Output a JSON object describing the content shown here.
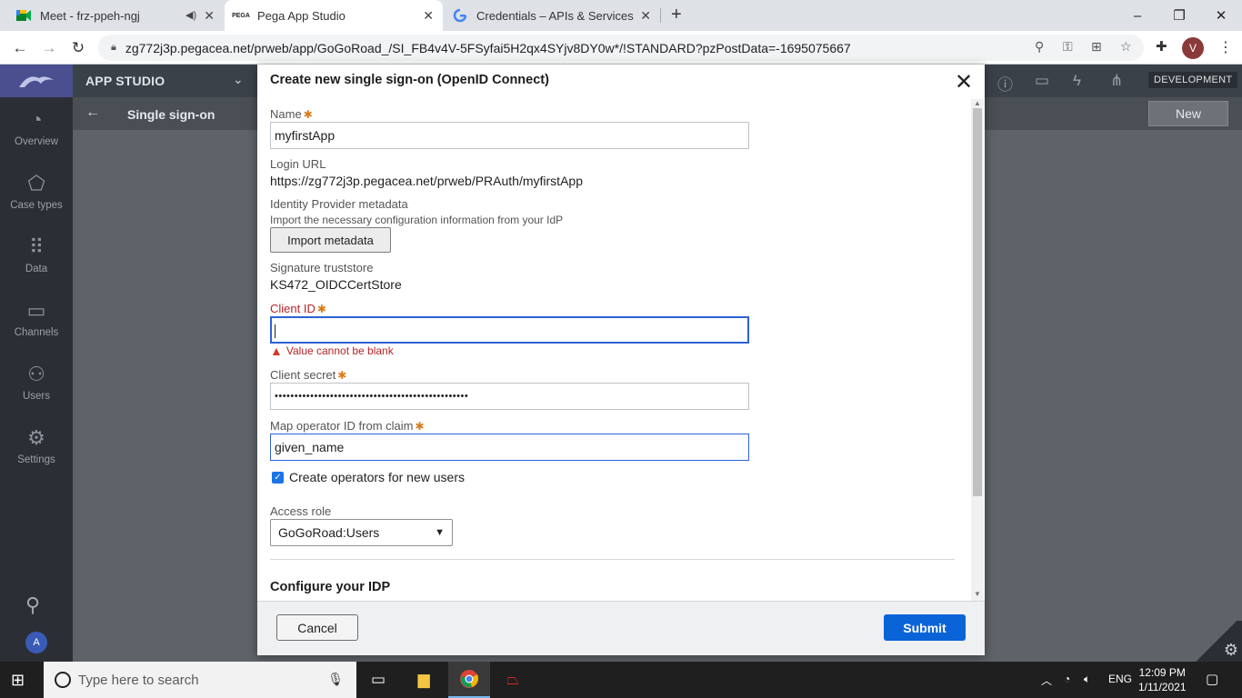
{
  "browser": {
    "tabs": [
      {
        "title": "Meet - frz-ppeh-ngj",
        "favicon": "google-meet-icon",
        "audio_icon": "speaker-icon"
      },
      {
        "title": "Pega App Studio",
        "favicon_text": "PEGA",
        "active": true
      },
      {
        "title": "Credentials – APIs & Services – M",
        "favicon": "google-g-icon"
      }
    ],
    "new_tab": "+",
    "url": "zg772j3p.pegacea.net/prweb/app/GoGoRoad_/SI_FB4v4V-5FSyfai5H2qx4SYjv8DY0w*/!STANDARD?pzPostData=-1695075667",
    "profile_initial": "V"
  },
  "app": {
    "title": "APP STUDIO",
    "environment": "DEVELOPMENT",
    "page_title": "Single sign-on",
    "new_button": "New",
    "nav": [
      {
        "label": "Overview",
        "icon": "gauge-icon"
      },
      {
        "label": "Case types",
        "icon": "case-type-icon"
      },
      {
        "label": "Data",
        "icon": "grid-dots-icon"
      },
      {
        "label": "Channels",
        "icon": "monitor-icon"
      },
      {
        "label": "Users",
        "icon": "users-icon"
      },
      {
        "label": "Settings",
        "icon": "gear-icon"
      }
    ],
    "user_initial": "A"
  },
  "modal": {
    "title": "Create new single sign-on (OpenID Connect)",
    "name_label": "Name",
    "name_value": "myfirstApp",
    "login_url_label": "Login URL",
    "login_url_value": "https://zg772j3p.pegacea.net/prweb/PRAuth/myfirstApp",
    "idp_metadata_label": "Identity Provider metadata",
    "idp_metadata_help": "Import the necessary configuration information from your IdP",
    "import_button": "Import metadata",
    "truststore_label": "Signature truststore",
    "truststore_value": "KS472_OIDCCertStore",
    "client_id_label": "Client ID",
    "client_id_value": "",
    "client_id_error": "Value cannot be blank",
    "client_secret_label": "Client secret",
    "client_secret_value": "•••••••••••••••••••••••••••••••••••••••••••••••••",
    "map_operator_label": "Map operator ID from claim",
    "map_operator_value": "given_name",
    "create_operators_label": "Create operators for new users",
    "create_operators_checked": true,
    "access_role_label": "Access role",
    "access_role_value": "GoGoRoad:Users",
    "configure_idp_heading": "Configure your IDP",
    "cancel_button": "Cancel",
    "submit_button": "Submit"
  },
  "taskbar": {
    "search_placeholder": "Type here to search",
    "language": "ENG",
    "time": "12:09 PM",
    "date": "1/11/2021"
  },
  "colors": {
    "accent": "#0b63d8",
    "error": "#b5242a",
    "required": "#d97c1a",
    "focus_border": "#2c62d8"
  }
}
